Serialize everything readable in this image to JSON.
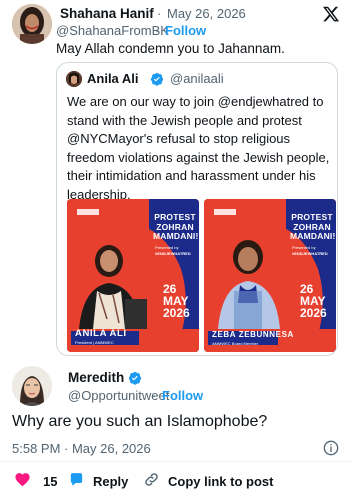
{
  "top_tweet": {
    "name": "Shahana Hanif",
    "date": "May 26, 2026",
    "handle": "@ShahanaFromBK",
    "follow_label": "Follow",
    "separator": "·",
    "text": "May Allah condemn you to Jahannam."
  },
  "quoted_tweet": {
    "name": "Anila Ali",
    "handle": "@anilaali",
    "text": "We are on our way to join @endjewhatred  to stand with the Jewish people and protest @NYCMayor's refusal to stop religious freedom violations against the Jewish people, their intimidation and harassment under his leadership.",
    "poster_left": {
      "protest_line1": "PROTEST",
      "protest_line2": "ZOHRAN",
      "protest_line3": "MAMDANI!!",
      "presented_by": "Presented by",
      "hashtag": "#ENDJEWHATRED",
      "date_day": "26",
      "date_month": "MAY",
      "date_year": "2026",
      "person": "ANILA ALI",
      "role": "President | AMMWEC"
    },
    "poster_right": {
      "protest_line1": "PROTEST",
      "protest_line2": "ZOHRAN",
      "protest_line3": "MAMDANI!!",
      "presented_by": "Presented by",
      "hashtag": "#ENDJEWHATRED",
      "date_day": "26",
      "date_month": "MAY",
      "date_year": "2026",
      "person": "ZEBA ZEBUNNESA",
      "role": "AMMWEC Board Member"
    }
  },
  "reply_tweet": {
    "name": "Meredith",
    "handle": "@Opportunitweet",
    "follow_label": "Follow",
    "separator": "·",
    "text": "Why are you such an Islamophobe?",
    "timestamp": "5:58 PM · May 26, 2026"
  },
  "actions": {
    "like_count": "15",
    "reply_label": "Reply",
    "copy_link_label": "Copy link to post"
  },
  "colors": {
    "accent": "#1d9bf0",
    "like_red": "#f91880",
    "poster_red": "#e8402f",
    "poster_navy": "#1c2a8a"
  }
}
